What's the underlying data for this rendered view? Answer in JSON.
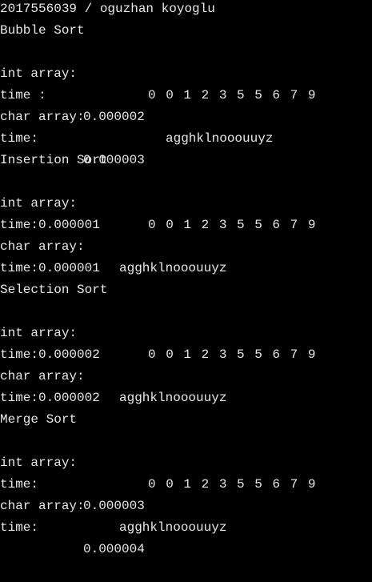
{
  "terminal": {
    "header": "2017556039 / oguzhan koyoglu",
    "sections": [
      {
        "title": "Bubble Sort",
        "int_label": "int array:",
        "int_values": "0 0 1 2 3 5 5 6 7 9",
        "time1_label": "time :",
        "time1_value": "0.000002",
        "char_label": "char array:",
        "char_values": "agghklnooouuyz",
        "time2_label": "time:",
        "time2_value": "0.000003"
      },
      {
        "title": "Insertion Sort",
        "int_label": "int array:",
        "int_values": "0 0 1 2 3 5 5 6 7 9",
        "time1_label": "time:0.000001",
        "char_label": "char array:",
        "char_values": "agghklnooouuyz",
        "time2_label": "time:0.000001"
      },
      {
        "title": "Selection Sort",
        "int_label": "int array:",
        "int_values": "0 0 1 2 3 5 5 6 7 9",
        "time1_label": "time:0.000002",
        "char_label": "char array:",
        "char_values": "agghklnooouuyz",
        "time2_label": "time:0.000002"
      },
      {
        "title": "Merge Sort",
        "int_label": "int array:",
        "int_values": "0 0 1 2 3 5 5 6 7 9",
        "time1_label": "time:",
        "time1_value": "0.000003",
        "char_label": "char array:",
        "char_values": "agghklnooouuyz",
        "time2_label": "time:",
        "time2_value": "0.000004"
      }
    ]
  },
  "colors": {
    "background": "#000000",
    "foreground": "#e8e8e8"
  }
}
